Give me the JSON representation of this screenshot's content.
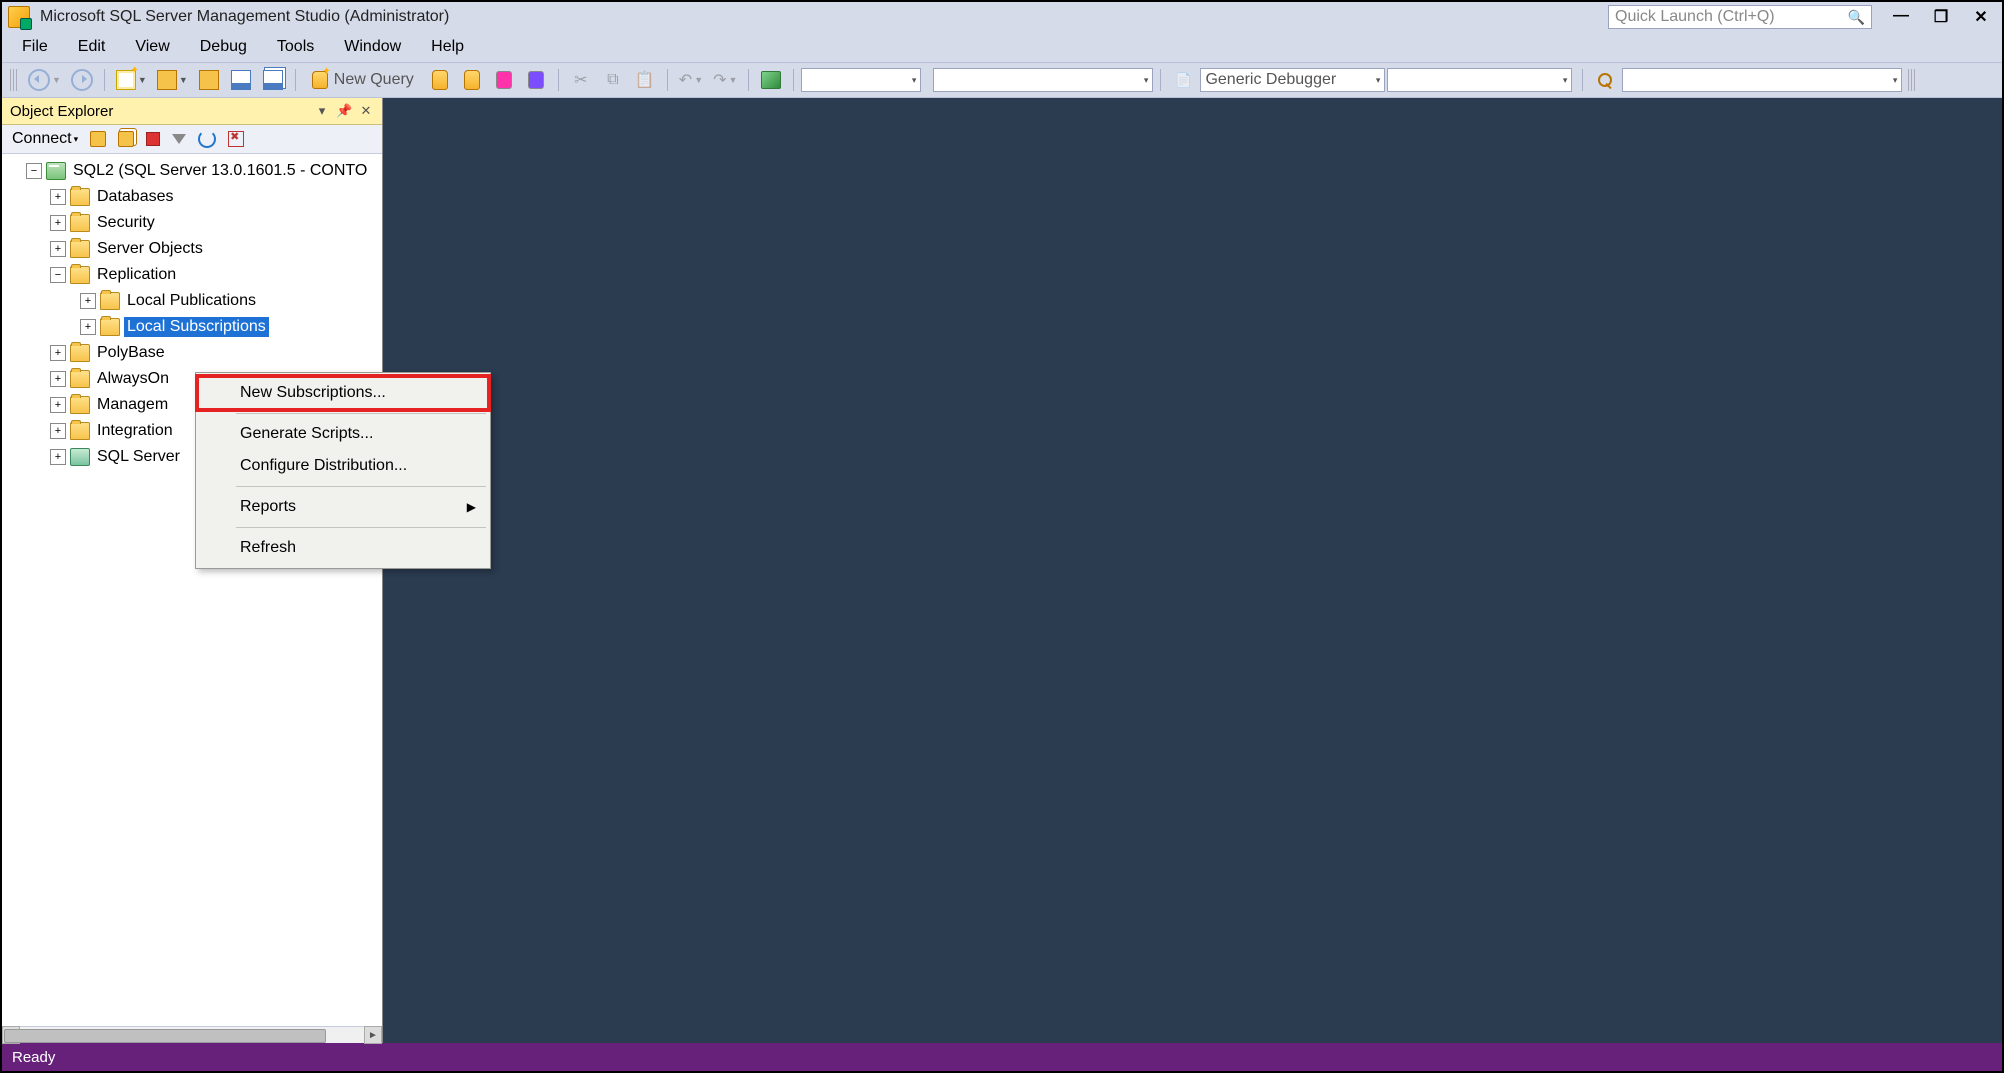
{
  "title_bar": {
    "title": "Microsoft SQL Server Management Studio (Administrator)",
    "quick_launch_placeholder": "Quick Launch (Ctrl+Q)"
  },
  "menu": {
    "file": "File",
    "edit": "Edit",
    "view": "View",
    "debug": "Debug",
    "tools": "Tools",
    "window": "Window",
    "help": "Help"
  },
  "toolbar": {
    "new_query": "New Query",
    "debugger_label": "Generic Debugger"
  },
  "object_explorer": {
    "title": "Object Explorer",
    "connect": "Connect",
    "server": "SQL2 (SQL Server 13.0.1601.5 - CONTO",
    "items": {
      "databases": "Databases",
      "security": "Security",
      "server_objects": "Server Objects",
      "replication": "Replication",
      "local_publications": "Local Publications",
      "local_subscriptions": "Local Subscriptions",
      "polybase": "PolyBase",
      "alwayson": "AlwaysOn",
      "management": "Managem",
      "integration": "Integration",
      "sql_server_agent": "SQL Server"
    }
  },
  "context_menu": {
    "new_subscriptions": "New Subscriptions...",
    "generate_scripts": "Generate Scripts...",
    "configure_distribution": "Configure Distribution...",
    "reports": "Reports",
    "refresh": "Refresh"
  },
  "status": {
    "text": "Ready"
  }
}
